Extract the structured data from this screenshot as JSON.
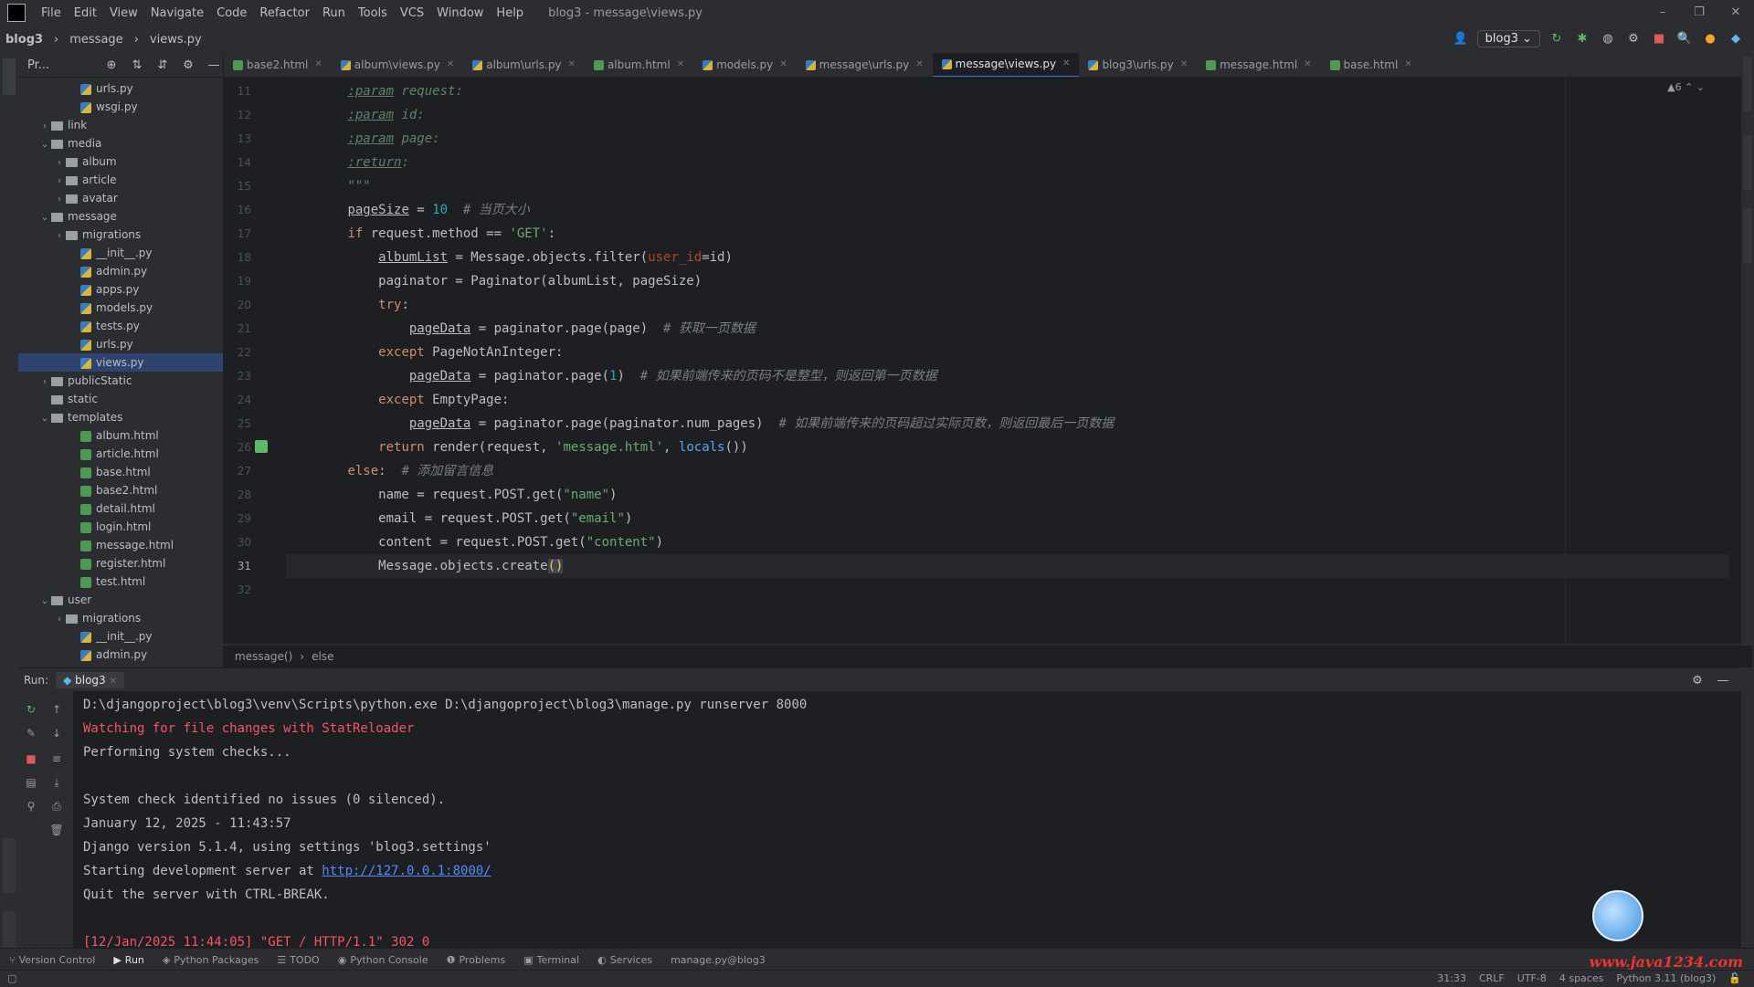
{
  "menubar": {
    "items": [
      "File",
      "Edit",
      "View",
      "Navigate",
      "Code",
      "Refactor",
      "Run",
      "Tools",
      "VCS",
      "Window",
      "Help"
    ],
    "window_title": "blog3 - message\\views.py",
    "controls": [
      "–",
      "❐",
      "✕"
    ]
  },
  "navbar": {
    "project": "blog3",
    "folder": "message",
    "file": "views.py",
    "run_config": "blog3"
  },
  "project_panel": {
    "title": "Pr...",
    "tree": [
      {
        "label": "urls.py",
        "type": "py",
        "indent": 3,
        "arrow": ""
      },
      {
        "label": "wsgi.py",
        "type": "py",
        "indent": 3,
        "arrow": ""
      },
      {
        "label": "link",
        "type": "folder",
        "indent": 1,
        "arrow": "›"
      },
      {
        "label": "media",
        "type": "folder",
        "indent": 1,
        "arrow": "⌄"
      },
      {
        "label": "album",
        "type": "folder",
        "indent": 2,
        "arrow": "›"
      },
      {
        "label": "article",
        "type": "folder",
        "indent": 2,
        "arrow": "›"
      },
      {
        "label": "avatar",
        "type": "folder",
        "indent": 2,
        "arrow": "›"
      },
      {
        "label": "message",
        "type": "folder",
        "indent": 1,
        "arrow": "⌄"
      },
      {
        "label": "migrations",
        "type": "folder",
        "indent": 2,
        "arrow": "›"
      },
      {
        "label": "__init__.py",
        "type": "py",
        "indent": 3,
        "arrow": ""
      },
      {
        "label": "admin.py",
        "type": "py",
        "indent": 3,
        "arrow": ""
      },
      {
        "label": "apps.py",
        "type": "py",
        "indent": 3,
        "arrow": ""
      },
      {
        "label": "models.py",
        "type": "py",
        "indent": 3,
        "arrow": ""
      },
      {
        "label": "tests.py",
        "type": "py",
        "indent": 3,
        "arrow": ""
      },
      {
        "label": "urls.py",
        "type": "py",
        "indent": 3,
        "arrow": ""
      },
      {
        "label": "views.py",
        "type": "py",
        "indent": 3,
        "arrow": "",
        "selected": true
      },
      {
        "label": "publicStatic",
        "type": "folder",
        "indent": 1,
        "arrow": "›"
      },
      {
        "label": "static",
        "type": "folder",
        "indent": 1,
        "arrow": ""
      },
      {
        "label": "templates",
        "type": "folder",
        "indent": 1,
        "arrow": "⌄"
      },
      {
        "label": "album.html",
        "type": "html",
        "indent": 3,
        "arrow": ""
      },
      {
        "label": "article.html",
        "type": "html",
        "indent": 3,
        "arrow": ""
      },
      {
        "label": "base.html",
        "type": "html",
        "indent": 3,
        "arrow": ""
      },
      {
        "label": "base2.html",
        "type": "html",
        "indent": 3,
        "arrow": ""
      },
      {
        "label": "detail.html",
        "type": "html",
        "indent": 3,
        "arrow": ""
      },
      {
        "label": "login.html",
        "type": "html",
        "indent": 3,
        "arrow": ""
      },
      {
        "label": "message.html",
        "type": "html",
        "indent": 3,
        "arrow": ""
      },
      {
        "label": "register.html",
        "type": "html",
        "indent": 3,
        "arrow": ""
      },
      {
        "label": "test.html",
        "type": "html",
        "indent": 3,
        "arrow": ""
      },
      {
        "label": "user",
        "type": "folder",
        "indent": 1,
        "arrow": "⌄"
      },
      {
        "label": "migrations",
        "type": "folder",
        "indent": 2,
        "arrow": "›"
      },
      {
        "label": "__init__.py",
        "type": "py",
        "indent": 3,
        "arrow": ""
      },
      {
        "label": "admin.py",
        "type": "py",
        "indent": 3,
        "arrow": ""
      }
    ]
  },
  "tabs": [
    {
      "label": "base2.html",
      "type": "html"
    },
    {
      "label": "album\\views.py",
      "type": "py"
    },
    {
      "label": "album\\urls.py",
      "type": "py"
    },
    {
      "label": "album.html",
      "type": "html"
    },
    {
      "label": "models.py",
      "type": "py"
    },
    {
      "label": "message\\urls.py",
      "type": "py"
    },
    {
      "label": "message\\views.py",
      "type": "py",
      "active": true
    },
    {
      "label": "blog3\\urls.py",
      "type": "py"
    },
    {
      "label": "message.html",
      "type": "html"
    },
    {
      "label": "base.html",
      "type": "html"
    }
  ],
  "editor": {
    "warning_badge": "▲6 ⌃ ⌄",
    "line_numbers": [
      "11",
      "12",
      "13",
      "14",
      "15",
      "16",
      "17",
      "18",
      "19",
      "20",
      "21",
      "22",
      "23",
      "24",
      "25",
      "26",
      "27",
      "28",
      "29",
      "30",
      "31",
      "32"
    ],
    "current_line_number": "31",
    "lines": [
      "        :param request:",
      "        :param id:",
      "        :param page:",
      "        :return:",
      "        \"\"\"",
      "        pageSize = 10  # 当页大小",
      "        if request.method == 'GET':",
      "            albumList = Message.objects.filter(user_id=id)",
      "            paginator = Paginator(albumList, pageSize)",
      "            try:",
      "                pageData = paginator.page(page)  # 获取一页数据",
      "            except PageNotAnInteger:",
      "                pageData = paginator.page(1)  # 如果前端传来的页码不是整型，则返回第一页数据",
      "            except EmptyPage:",
      "                pageData = paginator.page(paginator.num_pages)  # 如果前端传来的页码超过实际页数，则返回最后一页数据",
      "            return render(request, 'message.html', locals())",
      "        else:  # 添加留言信息",
      "            name = request.POST.get(\"name\")",
      "            email = request.POST.get(\"email\")",
      "            content = request.POST.get(\"content\")",
      "            Message.objects.create()",
      ""
    ]
  },
  "breadcrumbs": [
    "message()",
    "else"
  ],
  "run_panel": {
    "label": "Run:",
    "tab": "blog3",
    "console": [
      {
        "text": "D:\\djangoproject\\blog3\\venv\\Scripts\\python.exe D:\\djangoproject\\blog3\\manage.py runserver 8000",
        "style": "normal"
      },
      {
        "text": "Watching for file changes with StatReloader",
        "style": "red"
      },
      {
        "text": "Performing system checks...",
        "style": "normal"
      },
      {
        "text": "",
        "style": "normal"
      },
      {
        "text": "System check identified no issues (0 silenced).",
        "style": "normal"
      },
      {
        "text": "January 12, 2025 - 11:43:57",
        "style": "normal"
      },
      {
        "text": "Django version 5.1.4, using settings 'blog3.settings'",
        "style": "normal"
      },
      {
        "text": "Starting development server at ",
        "style": "link",
        "link": "http://127.0.0.1:8000/"
      },
      {
        "text": "Quit the server with CTRL-BREAK.",
        "style": "normal"
      },
      {
        "text": "",
        "style": "normal"
      },
      {
        "text": "[12/Jan/2025 11:44:05] \"GET / HTTP/1.1\" 302 0",
        "style": "red"
      }
    ]
  },
  "toolwindows": [
    {
      "label": "Version Control",
      "icon": "⑂"
    },
    {
      "label": "Run",
      "icon": "▶",
      "active": true
    },
    {
      "label": "Python Packages",
      "icon": "◈"
    },
    {
      "label": "TODO",
      "icon": "☰"
    },
    {
      "label": "Python Console",
      "icon": "◉"
    },
    {
      "label": "Problems",
      "icon": "❶"
    },
    {
      "label": "Terminal",
      "icon": "▣"
    },
    {
      "label": "Services",
      "icon": "◐"
    },
    {
      "label": "manage.py@blog3",
      "icon": ""
    }
  ],
  "statusbar": {
    "position": "31:33",
    "line_sep": "CRLF",
    "encoding": "UTF-8",
    "indent": "4 spaces",
    "interpreter": "Python 3.11 (blog3)"
  },
  "watermark": "www.java1234.com",
  "colors": {
    "accent": "#3574f0",
    "error": "#f75464",
    "link": "#548af7"
  }
}
